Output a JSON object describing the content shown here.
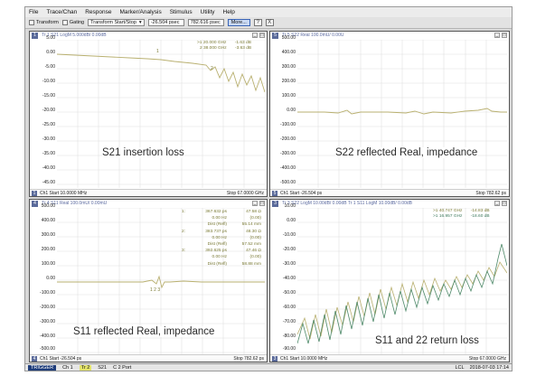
{
  "menubar": {
    "items": [
      "File",
      "Trace/Chan",
      "Response",
      "Marker/Analysis",
      "Stimulus",
      "Utility",
      "Help"
    ]
  },
  "toolbar": {
    "transform_label": "Transform",
    "gating_label": "Gating",
    "mode_value": "Transform Start/Stop",
    "start_value": "-26.504 psec",
    "stop_value": "782.616 psec",
    "more_label": "More...",
    "help_icon": "?",
    "close_icon": "X"
  },
  "panels": {
    "s21": {
      "number": "1",
      "header": "Tr 1  S21 LogM 5.000dB/  0.00dB",
      "yticks": [
        "5.00",
        "0.00",
        "-5.00",
        "-10.00",
        "-15.00",
        "-20.00",
        "-25.00",
        "-30.00",
        "-35.00",
        "-40.00",
        "-45.00"
      ],
      "markers": [
        {
          "id": ">1",
          "freq": "20.000 GHz",
          "val": "-1.63 dB"
        },
        {
          "id": "2",
          "freq": "38.000 GHz",
          "val": "-3.63 dB"
        }
      ],
      "footer_ch": "Ch1  Start  10.0000 MHz",
      "footer_stop": "Stop  67.0000 GHz",
      "caption": "S21 insertion loss"
    },
    "s22": {
      "number": "5",
      "header": "Tr 5  S22 Real 100.0mU/  0.00U",
      "yticks": [
        "500.00",
        "400.00",
        "300.00",
        "200.00",
        "100.00",
        "0.00",
        "-100.00",
        "-200.00",
        "-300.00",
        "-400.00",
        "-500.00"
      ],
      "footer_ch": "Ch1  Start  -26.504 ps",
      "footer_stop": "Stop  782.62 ps",
      "caption": "S22 reflected Real, impedance"
    },
    "s11r": {
      "number": "4",
      "header": "Tr 4  S11 Real 100.0mU/  0.00mU",
      "yticks": [
        "500.00",
        "400.00",
        "300.00",
        "200.00",
        "100.00",
        "0.00",
        "-100.00",
        "-200.00",
        "-300.00",
        "-400.00",
        "-500.00"
      ],
      "markers": [
        {
          "id": "1:",
          "freq": "367.632 ps",
          "val": "47.58 Ω"
        },
        {
          "id": "",
          "freq": "0.00 Hz",
          "val": "(0.00)"
        },
        {
          "id": "",
          "freq": "Dist (Refl)",
          "val": "55.14 mm"
        },
        {
          "id": "2:",
          "freq": "383.737 ps",
          "val": "48.30 Ω"
        },
        {
          "id": "",
          "freq": "0.00 Hz",
          "val": "(0.00)"
        },
        {
          "id": "",
          "freq": "Dist (Refl)",
          "val": "57.52 mm"
        },
        {
          "id": "3:",
          "freq": "392.625 ps",
          "val": "47.46 Ω"
        },
        {
          "id": "",
          "freq": "0.00 Hz",
          "val": "(0.00)"
        },
        {
          "id": "",
          "freq": "Dist (Refl)",
          "val": "58.88 mm"
        }
      ],
      "footer_ch": "Ch1  Start  -26.504 ps",
      "footer_stop": "Stop  782.62 ps",
      "caption": "S11 reflected Real, impedance"
    },
    "s11s22": {
      "number": "3",
      "header": "Tr 3  S22 LogM 10.00dB/  0.00dB   Tr 1  S11 LogM 10.00dB/  0.00dB",
      "yticks": [
        "10.00",
        "0.00",
        "-10.00",
        "-20.00",
        "-30.00",
        "-40.00",
        "-50.00",
        "-60.00",
        "-70.00",
        "-80.00",
        "-90.00"
      ],
      "markers": [
        {
          "id": ">1",
          "freq": "40.747 GHz",
          "val": "-14.83 dB"
        },
        {
          "id": ">1",
          "freq": "16.957 GHz",
          "val": "-18.60 dB"
        }
      ],
      "footer_ch": "Ch1  Start  10.0000 MHz",
      "footer_stop": "Stop  67.0000 GHz",
      "caption": "S11 and 22 return loss"
    }
  },
  "statusbar": {
    "mode": "TRIGGER",
    "channel": "Ch 1",
    "trace": "Tr 2",
    "param": "S21",
    "port": "C  2 Port",
    "lcl": "LCL",
    "timestamp": "2018-07-03 17:14"
  },
  "colors": {
    "trace_yellow": "#b9b070",
    "trace_green": "#4f8a6a",
    "grid": "#e0e0e0",
    "axis_label": "#222222"
  }
}
